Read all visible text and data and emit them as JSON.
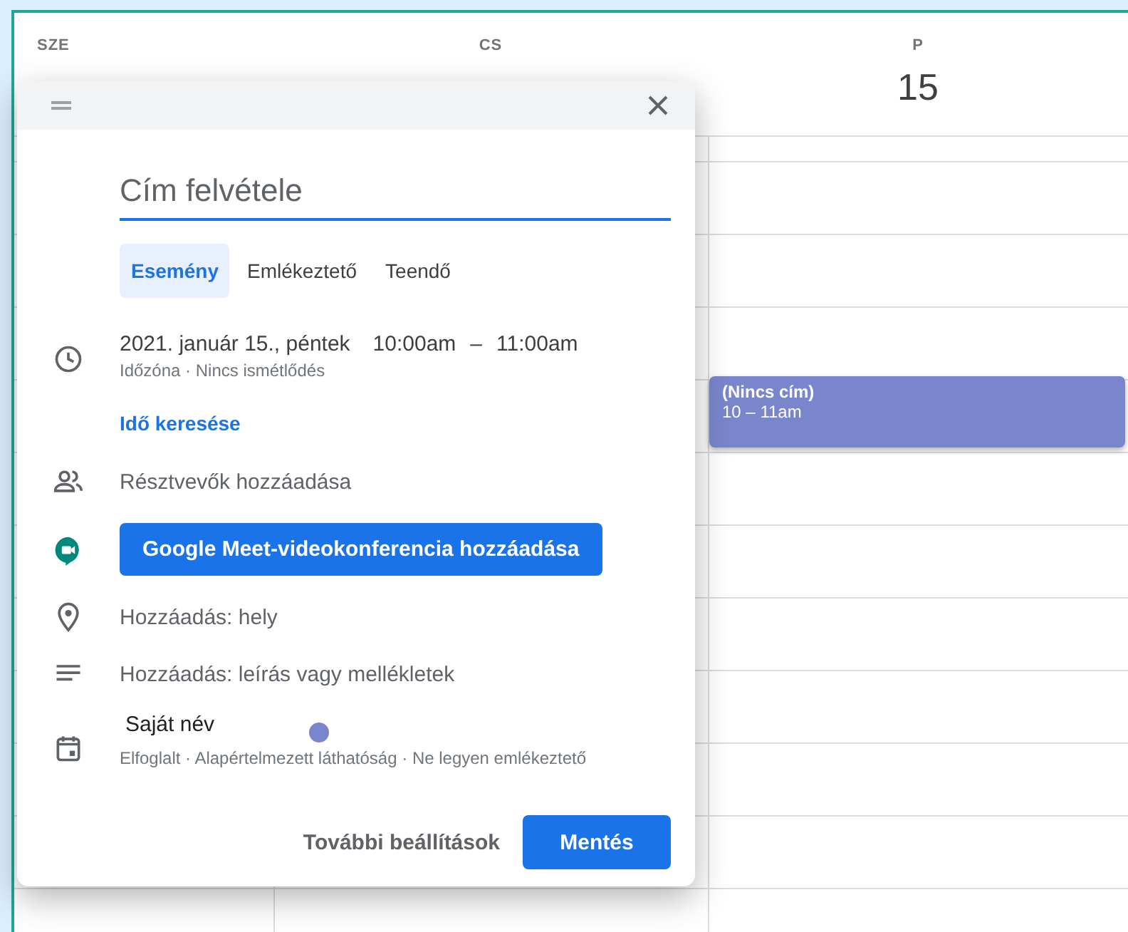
{
  "calendar": {
    "days": [
      {
        "label": "SZE"
      },
      {
        "label": "CS"
      },
      {
        "label": "P",
        "date": "15"
      }
    ],
    "event": {
      "title": "(Nincs cím)",
      "time": "10 – 11am"
    }
  },
  "dialog": {
    "title_field": {
      "placeholder": "Cím felvétele"
    },
    "tabs": [
      {
        "label": "Esemény",
        "selected": true
      },
      {
        "label": "Emlékeztető",
        "selected": false
      },
      {
        "label": "Teendő",
        "selected": false
      }
    ],
    "date": "2021. január 15., péntek",
    "start": "10:00am",
    "dash": "–",
    "end": "11:00am",
    "date_details": "Időzóna · Nincs ismétlődés",
    "find_time": "Idő keresése",
    "guests": "Résztvevők hozzáadása",
    "meet_button": "Google Meet-videokonferencia hozzáadása",
    "location": "Hozzáadás: hely",
    "description": "Hozzáadás: leírás vagy mellékletek",
    "calendar": {
      "name": "Saját név",
      "color": "#7986cb",
      "details": "Elfoglalt · Alapértelmezett láthatóság · Ne legyen emlékeztető"
    },
    "buttons": {
      "more": "További beállítások",
      "save": "Mentés"
    }
  }
}
